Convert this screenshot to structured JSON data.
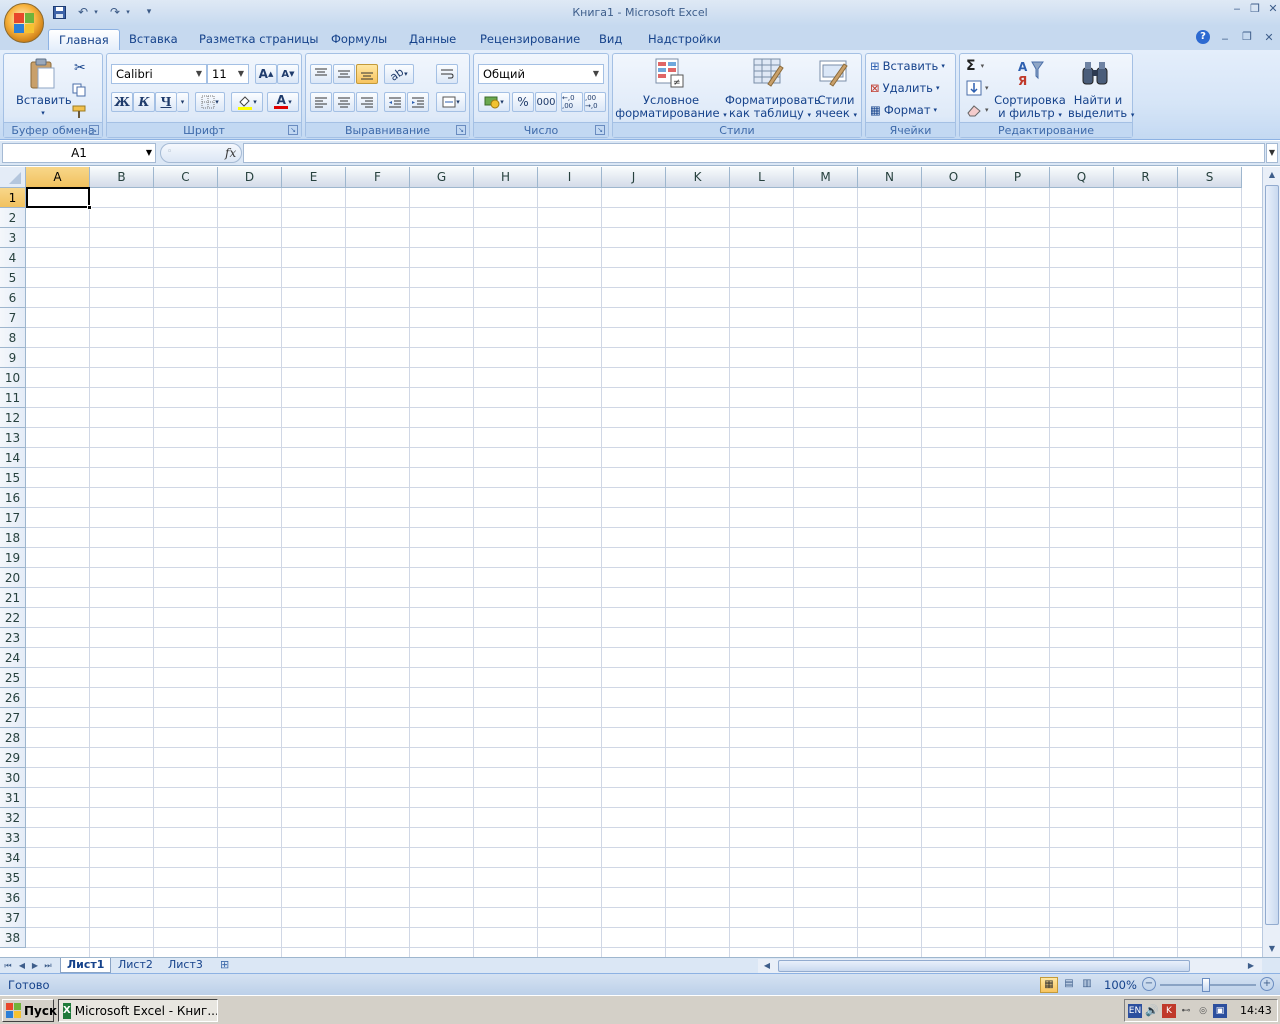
{
  "app": {
    "title": "Книга1  -  Microsoft Excel",
    "qat": {
      "save_icon": "save-icon",
      "undo_icon": "undo-icon",
      "redo_icon": "redo-icon",
      "customize_icon": "customize-qat-icon"
    }
  },
  "window_controls": {
    "minimize": "‒",
    "restore": "❐",
    "close": "✕"
  },
  "tabs": [
    {
      "label": "Главная",
      "active": true
    },
    {
      "label": "Вставка"
    },
    {
      "label": "Разметка страницы"
    },
    {
      "label": "Формулы"
    },
    {
      "label": "Данные"
    },
    {
      "label": "Рецензирование"
    },
    {
      "label": "Вид"
    },
    {
      "label": "Надстройки"
    }
  ],
  "ribbon": {
    "clipboard": {
      "label": "Буфер обмена",
      "paste": "Вставить"
    },
    "font": {
      "label": "Шрифт",
      "font_name": "Calibri",
      "font_size": "11",
      "bold": "Ж",
      "italic": "К",
      "underline": "Ч",
      "grow": "A",
      "shrink": "A",
      "font_color_letter": "A"
    },
    "alignment": {
      "label": "Выравнивание"
    },
    "number": {
      "label": "Число",
      "format": "Общий",
      "percent": "%",
      "thousands": "000",
      "inc_decimal": "←,0 ,00",
      "dec_decimal": ",00 →,0"
    },
    "styles": {
      "label": "Стили",
      "conditional_1": "Условное",
      "conditional_2": "форматирование",
      "astable_1": "Форматировать",
      "astable_2": "как таблицу",
      "cellstyles_1": "Стили",
      "cellstyles_2": "ячеек"
    },
    "cells": {
      "label": "Ячейки",
      "insert": "Вставить",
      "delete": "Удалить",
      "format": "Формат"
    },
    "editing": {
      "label": "Редактирование",
      "sigma": "Σ",
      "sort_1": "Сортировка",
      "sort_2": "и фильтр",
      "find_1": "Найти и",
      "find_2": "выделить"
    }
  },
  "formula_bar": {
    "name_box": "A1",
    "fx": "fx",
    "formula": ""
  },
  "grid": {
    "columns": [
      "A",
      "B",
      "C",
      "D",
      "E",
      "F",
      "G",
      "H",
      "I",
      "J",
      "K",
      "L",
      "M",
      "N",
      "O",
      "P",
      "Q",
      "R",
      "S"
    ],
    "rows": [
      "1",
      "2",
      "3",
      "4",
      "5",
      "6",
      "7",
      "8",
      "9",
      "10",
      "11",
      "12",
      "13",
      "14",
      "15",
      "16",
      "17",
      "18",
      "19",
      "20",
      "21",
      "22",
      "23",
      "24",
      "25",
      "26",
      "27",
      "28",
      "29",
      "30",
      "31",
      "32",
      "33",
      "34",
      "35",
      "36",
      "37",
      "38"
    ],
    "active_cell": "A1"
  },
  "sheets": [
    {
      "label": "Лист1",
      "active": true
    },
    {
      "label": "Лист2"
    },
    {
      "label": "Лист3"
    }
  ],
  "status": {
    "ready": "Готово",
    "zoom": "100%"
  },
  "taskbar": {
    "start": "Пуск",
    "item": "Microsoft Excel - Книг...",
    "lang": "EN",
    "clock": "14:43"
  }
}
